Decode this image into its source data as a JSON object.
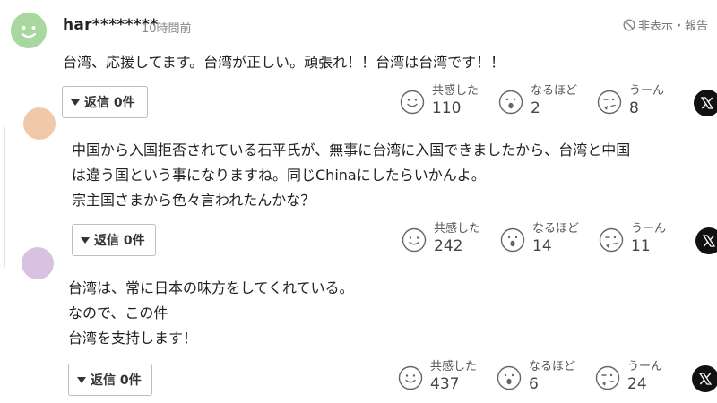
{
  "comments": [
    {
      "username": "har********",
      "time": "10時間前",
      "hide_report": "非表示・報告",
      "text": "台湾、応援してます。台湾が正しい。頑張れ！！台湾は台湾です！！",
      "reply_label": "返信 0件",
      "reactions": [
        {
          "label": "共感した",
          "count": "110",
          "icon": "smile-face-icon"
        },
        {
          "label": "なるほど",
          "count": "2",
          "icon": "surprised-face-icon"
        },
        {
          "label": "うーん",
          "count": "8",
          "icon": "thinking-face-icon"
        }
      ]
    },
    {
      "text": "中国から入国拒否されている石平氏が、無事に台湾に入国できましたから、台湾と中国\nは違う国という事になりますね。同じChinaにしたらいかんよ。\n宗主国さまから色々言われたんかな？",
      "reply_label": "返信 0件",
      "reactions": [
        {
          "label": "共感した",
          "count": "242",
          "icon": "smile-face-icon"
        },
        {
          "label": "なるほど",
          "count": "14",
          "icon": "surprised-face-icon"
        },
        {
          "label": "うーん",
          "count": "11",
          "icon": "thinking-face-icon"
        }
      ]
    },
    {
      "text": "台湾は、常に日本の味方をしてくれている。\nなので、この件\n台湾を支持します！",
      "reply_label": "返信 0件",
      "reactions": [
        {
          "label": "共感した",
          "count": "437",
          "icon": "smile-face-icon"
        },
        {
          "label": "なるほど",
          "count": "6",
          "icon": "surprised-face-icon"
        },
        {
          "label": "うーん",
          "count": "24",
          "icon": "thinking-face-icon"
        }
      ]
    }
  ],
  "share_icon": "x-share-icon",
  "colors": {
    "avatar_green": "#a8d8a0",
    "avatar_peach": "#f2c9a8",
    "avatar_lilac": "#d8c2e2",
    "x_button": "#111111"
  }
}
